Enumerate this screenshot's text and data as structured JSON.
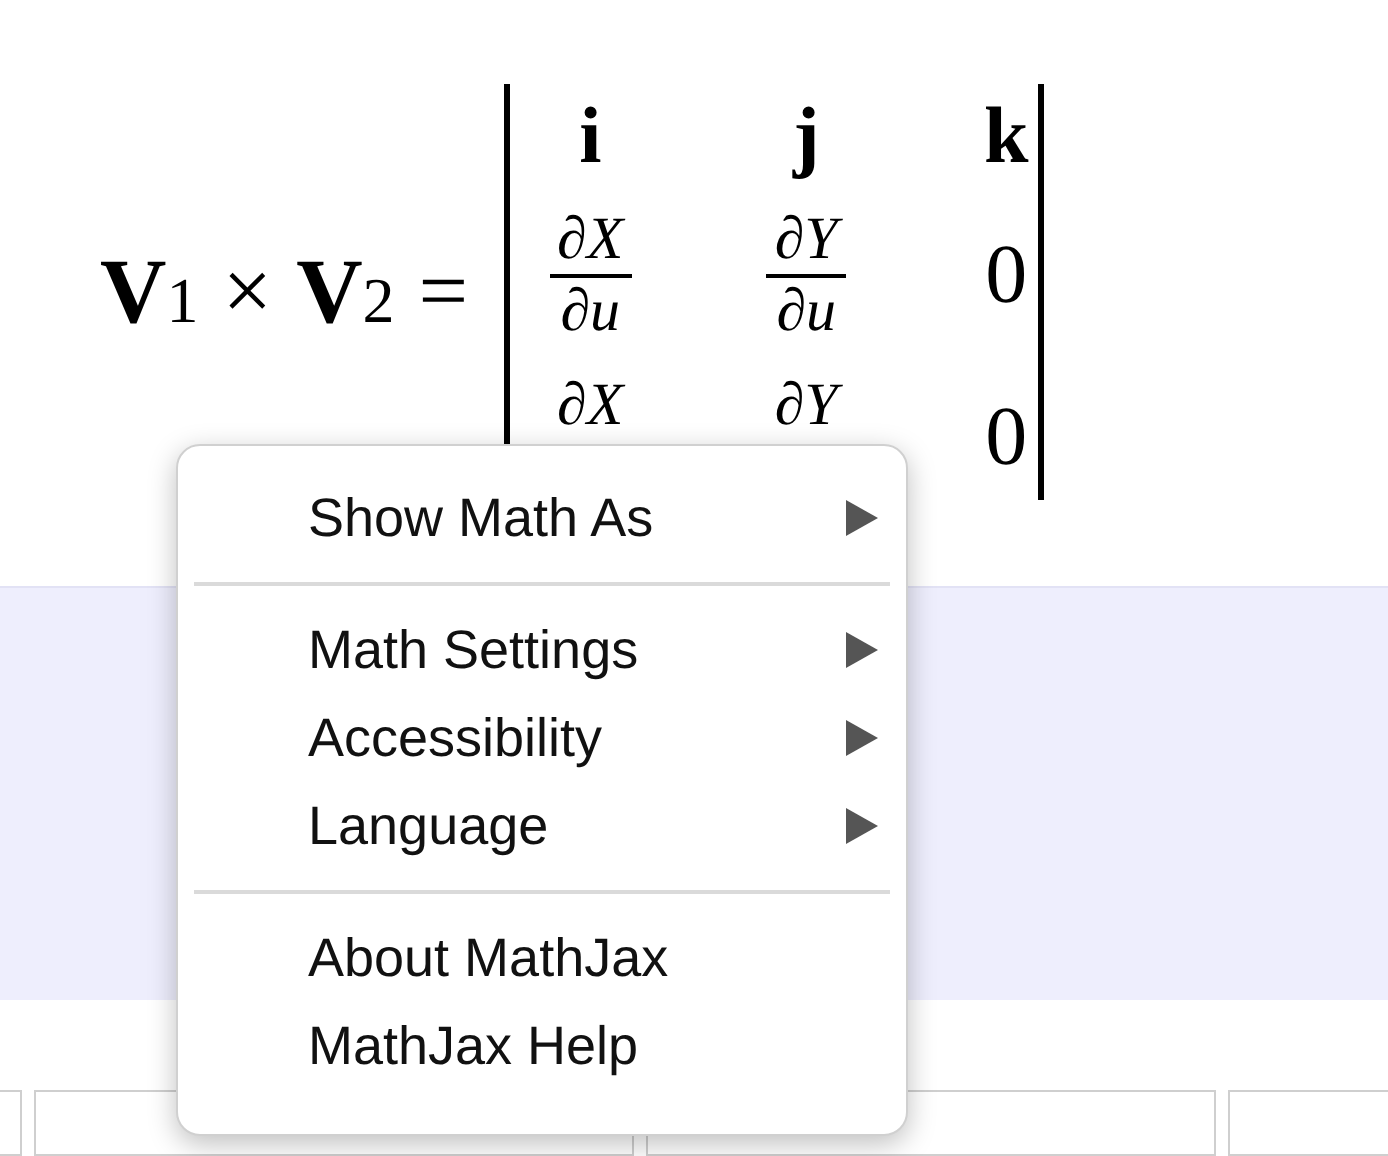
{
  "formula": {
    "terms": [
      {
        "kind": "vector",
        "text": "V",
        "sub": "1"
      },
      {
        "kind": "op",
        "text": "×"
      },
      {
        "kind": "vector",
        "text": "V",
        "sub": "2"
      },
      {
        "kind": "op",
        "text": "="
      }
    ],
    "matrix": [
      [
        {
          "kind": "bold",
          "text": "i"
        },
        {
          "kind": "bold",
          "text": "j"
        },
        {
          "kind": "bold",
          "text": "k"
        }
      ],
      [
        {
          "kind": "fraction",
          "num": "∂X",
          "den": "∂u"
        },
        {
          "kind": "fraction",
          "num": "∂Y",
          "den": "∂u"
        },
        {
          "kind": "plain",
          "text": "0"
        }
      ],
      [
        {
          "kind": "fraction",
          "num": "∂X"
        },
        {
          "kind": "fraction",
          "num": "∂Y"
        },
        {
          "kind": "plain",
          "text": "0"
        }
      ]
    ]
  },
  "menu": {
    "groups": [
      [
        {
          "label": "Show Math As",
          "submenu": true
        }
      ],
      [
        {
          "label": "Math Settings",
          "submenu": true
        },
        {
          "label": "Accessibility",
          "submenu": true
        },
        {
          "label": "Language",
          "submenu": true
        }
      ],
      [
        {
          "label": "About MathJax",
          "submenu": false
        },
        {
          "label": "MathJax Help",
          "submenu": false
        }
      ]
    ]
  }
}
